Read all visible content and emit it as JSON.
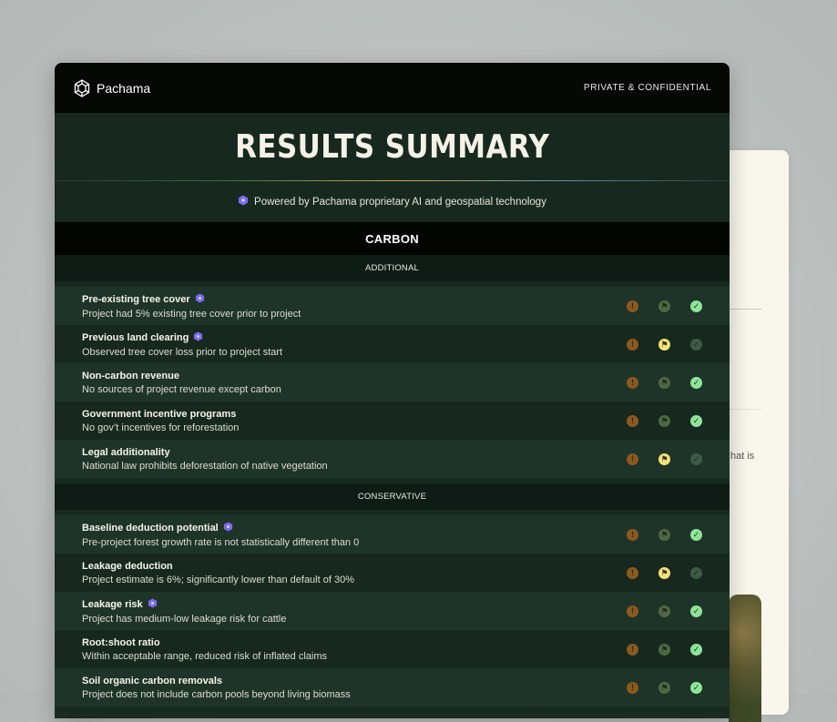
{
  "header": {
    "brand": "Pachama",
    "confidential": "PRIVATE & CONFIDENTIAL"
  },
  "title": "RESULTS SUMMARY",
  "powered_by": "Powered by Pachama proprietary AI and geospatial technology",
  "section": "CARBON",
  "groups": [
    {
      "label": "ADDITIONAL",
      "rows": [
        {
          "name": "Pre-existing tree cover",
          "ai": true,
          "desc": "Project had 5% existing tree cover prior to project",
          "result": "pass"
        },
        {
          "name": "Previous land clearing",
          "ai": true,
          "desc": "Observed tree cover loss prior to project start",
          "result": "flag"
        },
        {
          "name": "Non-carbon revenue",
          "ai": false,
          "desc": "No sources of project revenue except carbon",
          "result": "pass"
        },
        {
          "name": "Government incentive programs",
          "ai": false,
          "desc": "No gov’t incentives for reforestation",
          "result": "pass"
        },
        {
          "name": "Legal additionality",
          "ai": false,
          "desc": "National law prohibits deforestation of native vegetation",
          "result": "flag"
        }
      ]
    },
    {
      "label": "CONSERVATIVE",
      "rows": [
        {
          "name": "Baseline deduction potential",
          "ai": true,
          "desc": "Pre-project forest growth rate is not statistically different than 0",
          "result": "pass"
        },
        {
          "name": "Leakage deduction",
          "ai": false,
          "desc": "Project estimate is 6%; significantly lower than default of 30%",
          "result": "flag"
        },
        {
          "name": "Leakage risk",
          "ai": true,
          "desc": "Project has medium-low leakage risk for cattle",
          "result": "pass"
        },
        {
          "name": "Root:shoot ratio",
          "ai": false,
          "desc": "Within acceptable range, reduced risk of inflated claims",
          "result": "pass"
        },
        {
          "name": "Soil organic carbon removals",
          "ai": false,
          "desc": "Project does not include carbon pools beyond living biomass",
          "result": "pass"
        }
      ]
    }
  ],
  "status_icons": {
    "warning": "!",
    "flag": "⚑",
    "check": "✓"
  },
  "background_card": {
    "peek_text": "hat is"
  },
  "colors": {
    "ai_badge": "#7b6cf0",
    "pass": "#8fe49a",
    "flag": "#f2e27a",
    "warning": "#8b5a1f"
  }
}
